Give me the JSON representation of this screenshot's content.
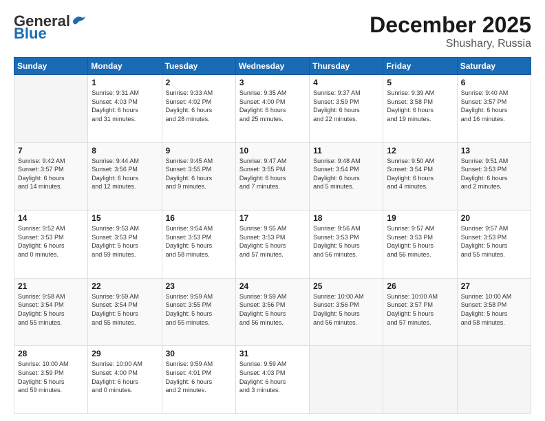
{
  "header": {
    "logo_general": "General",
    "logo_blue": "Blue",
    "month_title": "December 2025",
    "location": "Shushary, Russia"
  },
  "days_of_week": [
    "Sunday",
    "Monday",
    "Tuesday",
    "Wednesday",
    "Thursday",
    "Friday",
    "Saturday"
  ],
  "weeks": [
    [
      {
        "day": "",
        "info": ""
      },
      {
        "day": "1",
        "info": "Sunrise: 9:31 AM\nSunset: 4:03 PM\nDaylight: 6 hours\nand 31 minutes."
      },
      {
        "day": "2",
        "info": "Sunrise: 9:33 AM\nSunset: 4:02 PM\nDaylight: 6 hours\nand 28 minutes."
      },
      {
        "day": "3",
        "info": "Sunrise: 9:35 AM\nSunset: 4:00 PM\nDaylight: 6 hours\nand 25 minutes."
      },
      {
        "day": "4",
        "info": "Sunrise: 9:37 AM\nSunset: 3:59 PM\nDaylight: 6 hours\nand 22 minutes."
      },
      {
        "day": "5",
        "info": "Sunrise: 9:39 AM\nSunset: 3:58 PM\nDaylight: 6 hours\nand 19 minutes."
      },
      {
        "day": "6",
        "info": "Sunrise: 9:40 AM\nSunset: 3:57 PM\nDaylight: 6 hours\nand 16 minutes."
      }
    ],
    [
      {
        "day": "7",
        "info": "Sunrise: 9:42 AM\nSunset: 3:57 PM\nDaylight: 6 hours\nand 14 minutes."
      },
      {
        "day": "8",
        "info": "Sunrise: 9:44 AM\nSunset: 3:56 PM\nDaylight: 6 hours\nand 12 minutes."
      },
      {
        "day": "9",
        "info": "Sunrise: 9:45 AM\nSunset: 3:55 PM\nDaylight: 6 hours\nand 9 minutes."
      },
      {
        "day": "10",
        "info": "Sunrise: 9:47 AM\nSunset: 3:55 PM\nDaylight: 6 hours\nand 7 minutes."
      },
      {
        "day": "11",
        "info": "Sunrise: 9:48 AM\nSunset: 3:54 PM\nDaylight: 6 hours\nand 5 minutes."
      },
      {
        "day": "12",
        "info": "Sunrise: 9:50 AM\nSunset: 3:54 PM\nDaylight: 6 hours\nand 4 minutes."
      },
      {
        "day": "13",
        "info": "Sunrise: 9:51 AM\nSunset: 3:53 PM\nDaylight: 6 hours\nand 2 minutes."
      }
    ],
    [
      {
        "day": "14",
        "info": "Sunrise: 9:52 AM\nSunset: 3:53 PM\nDaylight: 6 hours\nand 0 minutes."
      },
      {
        "day": "15",
        "info": "Sunrise: 9:53 AM\nSunset: 3:53 PM\nDaylight: 5 hours\nand 59 minutes."
      },
      {
        "day": "16",
        "info": "Sunrise: 9:54 AM\nSunset: 3:53 PM\nDaylight: 5 hours\nand 58 minutes."
      },
      {
        "day": "17",
        "info": "Sunrise: 9:55 AM\nSunset: 3:53 PM\nDaylight: 5 hours\nand 57 minutes."
      },
      {
        "day": "18",
        "info": "Sunrise: 9:56 AM\nSunset: 3:53 PM\nDaylight: 5 hours\nand 56 minutes."
      },
      {
        "day": "19",
        "info": "Sunrise: 9:57 AM\nSunset: 3:53 PM\nDaylight: 5 hours\nand 56 minutes."
      },
      {
        "day": "20",
        "info": "Sunrise: 9:57 AM\nSunset: 3:53 PM\nDaylight: 5 hours\nand 55 minutes."
      }
    ],
    [
      {
        "day": "21",
        "info": "Sunrise: 9:58 AM\nSunset: 3:54 PM\nDaylight: 5 hours\nand 55 minutes."
      },
      {
        "day": "22",
        "info": "Sunrise: 9:59 AM\nSunset: 3:54 PM\nDaylight: 5 hours\nand 55 minutes."
      },
      {
        "day": "23",
        "info": "Sunrise: 9:59 AM\nSunset: 3:55 PM\nDaylight: 5 hours\nand 55 minutes."
      },
      {
        "day": "24",
        "info": "Sunrise: 9:59 AM\nSunset: 3:56 PM\nDaylight: 5 hours\nand 56 minutes."
      },
      {
        "day": "25",
        "info": "Sunrise: 10:00 AM\nSunset: 3:56 PM\nDaylight: 5 hours\nand 56 minutes."
      },
      {
        "day": "26",
        "info": "Sunrise: 10:00 AM\nSunset: 3:57 PM\nDaylight: 5 hours\nand 57 minutes."
      },
      {
        "day": "27",
        "info": "Sunrise: 10:00 AM\nSunset: 3:58 PM\nDaylight: 5 hours\nand 58 minutes."
      }
    ],
    [
      {
        "day": "28",
        "info": "Sunrise: 10:00 AM\nSunset: 3:59 PM\nDaylight: 5 hours\nand 59 minutes."
      },
      {
        "day": "29",
        "info": "Sunrise: 10:00 AM\nSunset: 4:00 PM\nDaylight: 6 hours\nand 0 minutes."
      },
      {
        "day": "30",
        "info": "Sunrise: 9:59 AM\nSunset: 4:01 PM\nDaylight: 6 hours\nand 2 minutes."
      },
      {
        "day": "31",
        "info": "Sunrise: 9:59 AM\nSunset: 4:03 PM\nDaylight: 6 hours\nand 3 minutes."
      },
      {
        "day": "",
        "info": ""
      },
      {
        "day": "",
        "info": ""
      },
      {
        "day": "",
        "info": ""
      }
    ]
  ]
}
